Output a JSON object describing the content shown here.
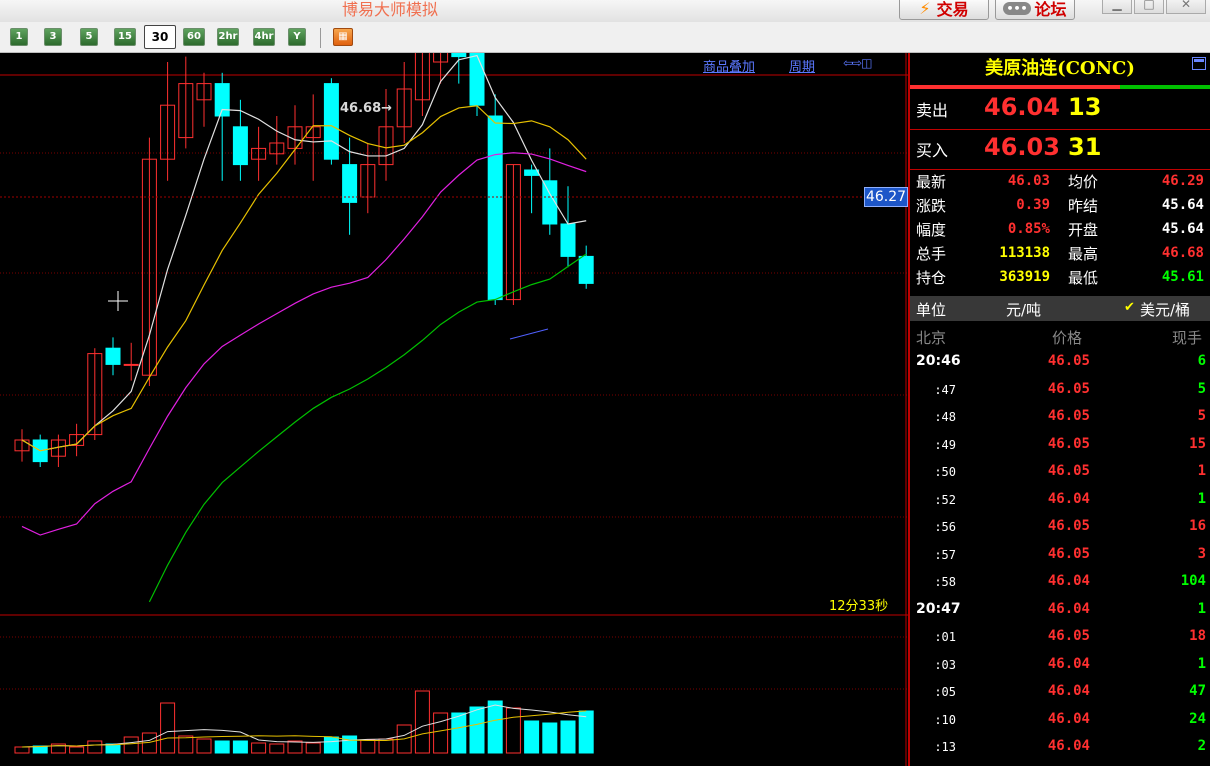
{
  "window": {
    "title": "博易大师模拟",
    "trade_button": "交易",
    "forum_button": "论坛"
  },
  "toolbar": {
    "periods": [
      "1",
      "3",
      "5",
      "15",
      "30",
      "60",
      "2hr",
      "4hr",
      "Y"
    ],
    "active_period": "30"
  },
  "chart": {
    "overlay_link": "商品叠加",
    "period_link": "周期",
    "current_price_tag": "46.27",
    "high_label": "46.68",
    "countdown": "12分33秒"
  },
  "chart_data": {
    "type": "candlestick",
    "symbol": "美原油连(CONC)",
    "period": "30",
    "ohlc": [
      [
        45.8,
        45.84,
        45.78,
        45.82
      ],
      [
        45.82,
        45.83,
        45.77,
        45.78
      ],
      [
        45.79,
        45.83,
        45.77,
        45.82
      ],
      [
        45.81,
        45.85,
        45.79,
        45.83
      ],
      [
        45.83,
        45.99,
        45.82,
        45.98
      ],
      [
        45.99,
        46.01,
        45.94,
        45.96
      ],
      [
        45.96,
        46.0,
        45.93,
        45.96
      ],
      [
        45.94,
        46.38,
        45.92,
        46.34
      ],
      [
        46.34,
        46.52,
        46.3,
        46.44
      ],
      [
        46.38,
        46.53,
        46.36,
        46.48
      ],
      [
        46.45,
        46.5,
        46.4,
        46.48
      ],
      [
        46.48,
        46.5,
        46.3,
        46.42
      ],
      [
        46.4,
        46.45,
        46.3,
        46.33
      ],
      [
        46.34,
        46.4,
        46.3,
        46.36
      ],
      [
        46.35,
        46.42,
        46.33,
        46.37
      ],
      [
        46.36,
        46.44,
        46.33,
        46.4
      ],
      [
        46.38,
        46.46,
        46.3,
        46.4
      ],
      [
        46.48,
        46.49,
        46.33,
        46.34
      ],
      [
        46.33,
        46.38,
        46.2,
        46.26
      ],
      [
        46.27,
        46.37,
        46.24,
        46.33
      ],
      [
        46.33,
        46.47,
        46.3,
        46.4
      ],
      [
        46.4,
        46.52,
        46.37,
        46.47
      ],
      [
        46.45,
        46.58,
        46.42,
        46.56
      ],
      [
        46.52,
        46.68,
        46.48,
        46.66
      ],
      [
        46.64,
        46.66,
        46.48,
        46.53
      ],
      [
        46.56,
        46.57,
        46.42,
        46.44
      ],
      [
        46.42,
        46.46,
        46.07,
        46.08
      ],
      [
        46.08,
        46.33,
        46.07,
        46.33
      ],
      [
        46.32,
        46.33,
        46.24,
        46.31
      ],
      [
        46.3,
        46.36,
        46.2,
        46.22
      ],
      [
        46.22,
        46.29,
        46.14,
        46.16
      ],
      [
        46.16,
        46.18,
        46.1,
        46.11
      ]
    ],
    "volume": [
      6,
      7,
      9,
      6,
      12,
      9,
      16,
      20,
      50,
      17,
      14,
      12,
      12,
      10,
      9,
      12,
      10,
      16,
      17,
      13,
      14,
      28,
      62,
      40,
      40,
      46,
      52,
      45,
      32,
      30,
      32,
      42
    ],
    "price_axis_marker": 46.27
  },
  "panel": {
    "title": "美原油连(CONC)",
    "sell_label": "卖出",
    "sell_price": "46.04",
    "sell_vol": "13",
    "buy_label": "买入",
    "buy_price": "46.03",
    "buy_vol": "31",
    "stats": [
      {
        "l1": "最新",
        "v1": "46.03",
        "c1": "#ff3030",
        "l2": "均价",
        "v2": "46.29",
        "c2": "#ff3030"
      },
      {
        "l1": "涨跌",
        "v1": "0.39",
        "c1": "#ff3030",
        "l2": "昨结",
        "v2": "45.64",
        "c2": "#ffffff"
      },
      {
        "l1": "幅度",
        "v1": "0.85%",
        "c1": "#ff3030",
        "l2": "开盘",
        "v2": "45.64",
        "c2": "#ffffff"
      },
      {
        "l1": "总手",
        "v1": "113138",
        "c1": "#ffff00",
        "l2": "最高",
        "v2": "46.68",
        "c2": "#ff3030"
      },
      {
        "l1": "持仓",
        "v1": "363919",
        "c1": "#ffff00",
        "l2": "最低",
        "v2": "45.61",
        "c2": "#00ff00"
      }
    ],
    "unit_label": "单位",
    "unit_cny": "元/吨",
    "unit_usd": "美元/桶",
    "ticks_header": {
      "time": "北京",
      "price": "价格",
      "vol": "现手"
    },
    "ticks": [
      {
        "time": "20:46",
        "price": "46.05",
        "vol": "6",
        "vcolor": "#00ff00"
      },
      {
        "time": ":47",
        "price": "46.05",
        "vol": "5",
        "vcolor": "#00ff00"
      },
      {
        "time": ":48",
        "price": "46.05",
        "vol": "5",
        "vcolor": "#ff3030"
      },
      {
        "time": ":49",
        "price": "46.05",
        "vol": "15",
        "vcolor": "#ff3030"
      },
      {
        "time": ":50",
        "price": "46.05",
        "vol": "1",
        "vcolor": "#ff3030"
      },
      {
        "time": ":52",
        "price": "46.04",
        "vol": "1",
        "vcolor": "#00ff00"
      },
      {
        "time": ":56",
        "price": "46.05",
        "vol": "16",
        "vcolor": "#ff3030"
      },
      {
        "time": ":57",
        "price": "46.05",
        "vol": "3",
        "vcolor": "#ff3030"
      },
      {
        "time": ":58",
        "price": "46.04",
        "vol": "104",
        "vcolor": "#00ff00"
      },
      {
        "time": "20:47",
        "price": "46.04",
        "vol": "1",
        "vcolor": "#00ff00"
      },
      {
        "time": ":01",
        "price": "46.05",
        "vol": "18",
        "vcolor": "#ff3030"
      },
      {
        "time": ":03",
        "price": "46.04",
        "vol": "1",
        "vcolor": "#00ff00"
      },
      {
        "time": ":05",
        "price": "46.04",
        "vol": "47",
        "vcolor": "#00ff00"
      },
      {
        "time": ":10",
        "price": "46.04",
        "vol": "24",
        "vcolor": "#00ff00"
      },
      {
        "time": ":13",
        "price": "46.04",
        "vol": "2",
        "vcolor": "#00ff00"
      }
    ]
  },
  "colors": {
    "up": "#ff3030",
    "down": "#00ffff",
    "ma5": "#e0e0e0",
    "ma10": "#e6c000",
    "ma20": "#e020e0",
    "ma60": "#00c000"
  }
}
